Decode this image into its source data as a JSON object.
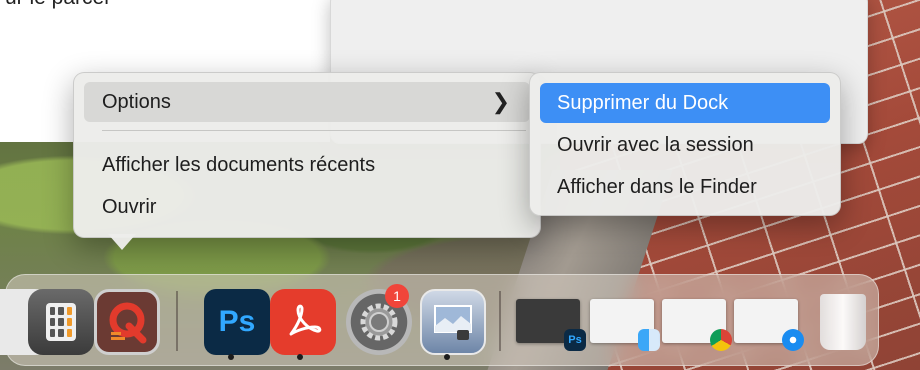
{
  "background": {
    "partial_text": "ur le parcel"
  },
  "context_menu": {
    "options_label": "Options",
    "recent_documents_label": "Afficher les documents récents",
    "open_label": "Ouvrir"
  },
  "options_submenu": {
    "remove_from_dock_label": "Supprimer du Dock",
    "open_at_login_label": "Ouvrir avec la session",
    "show_in_finder_label": "Afficher dans le Finder"
  },
  "dock": {
    "apps": [
      {
        "name": "app-partial-left",
        "icon": "app-icon"
      },
      {
        "name": "calculator",
        "icon": "calculator-icon"
      },
      {
        "name": "q-app",
        "icon": "q-app-icon",
        "selected": true
      },
      {
        "name": "photoshop",
        "icon": "photoshop-icon",
        "label": "Ps",
        "running": true
      },
      {
        "name": "acrobat",
        "icon": "acrobat-icon",
        "running": true
      },
      {
        "name": "system-preferences",
        "icon": "gear-icon"
      },
      {
        "name": "preview",
        "icon": "preview-icon",
        "running": true
      }
    ],
    "system_prefs_badge": "1",
    "minimized_windows": [
      {
        "name": "photoshop-window",
        "badge_icon": "photoshop-icon",
        "badge_label": "Ps"
      },
      {
        "name": "finder-window",
        "badge_icon": "finder-icon"
      },
      {
        "name": "chrome-window",
        "badge_icon": "chrome-icon"
      },
      {
        "name": "safari-window",
        "badge_icon": "safari-icon"
      }
    ],
    "trash_icon": "trash-icon"
  },
  "colors": {
    "menu_background": "#ececea",
    "selected_item": "#3d8ff5",
    "hover_item": "#d8d8d6",
    "badge": "#f0453a"
  }
}
